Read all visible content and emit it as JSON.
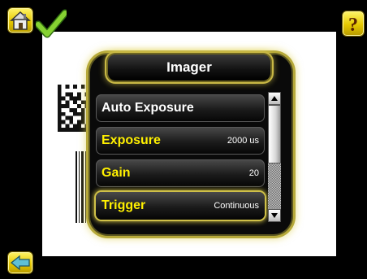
{
  "colors": {
    "background": "#000000",
    "accent": "#fff000",
    "button_yellow": "#f4dc1c",
    "check_green": "#7fcf2a"
  },
  "icons": {
    "home": "home-icon",
    "status": "checkmark-icon",
    "help": "question-mark-icon",
    "back": "back-arrow-icon"
  },
  "menu": {
    "title": "Imager",
    "items": [
      {
        "label": "Auto Exposure",
        "value": ""
      },
      {
        "label": "Exposure",
        "value": "2000 us"
      },
      {
        "label": "Gain",
        "value": "20"
      },
      {
        "label": "Trigger",
        "value": "Continuous"
      }
    ]
  }
}
